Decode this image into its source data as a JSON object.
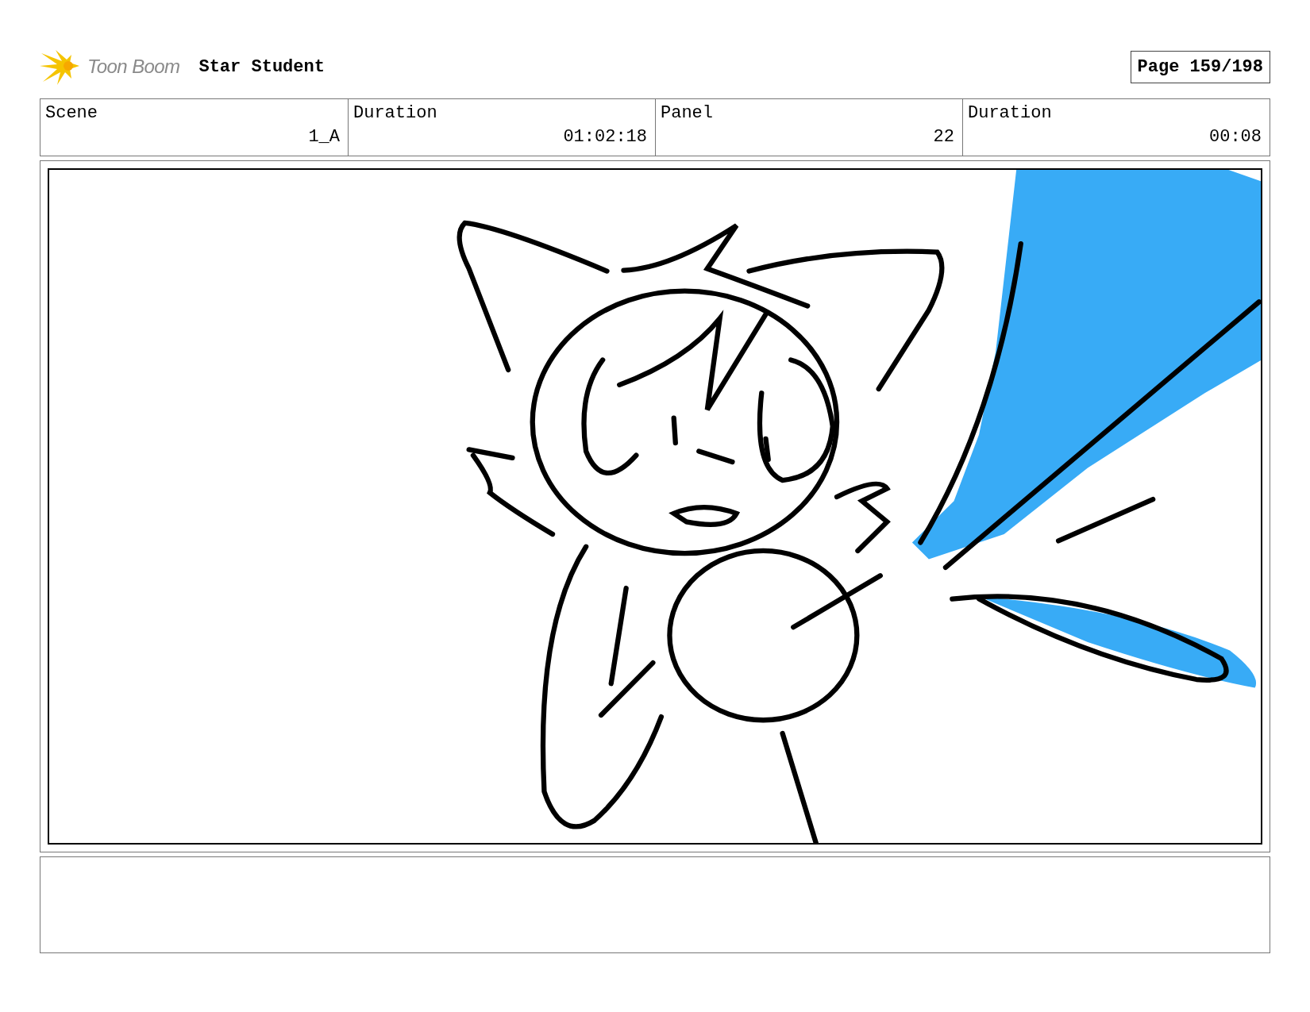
{
  "header": {
    "logo_text": "Toon Boom",
    "project_title": "Star Student",
    "page": "Page 159/198"
  },
  "info_table": {
    "labels": [
      "Scene",
      "Duration",
      "Panel",
      "Duration"
    ],
    "values": [
      "1_A",
      "01:02:18",
      "22",
      "00:08"
    ]
  }
}
